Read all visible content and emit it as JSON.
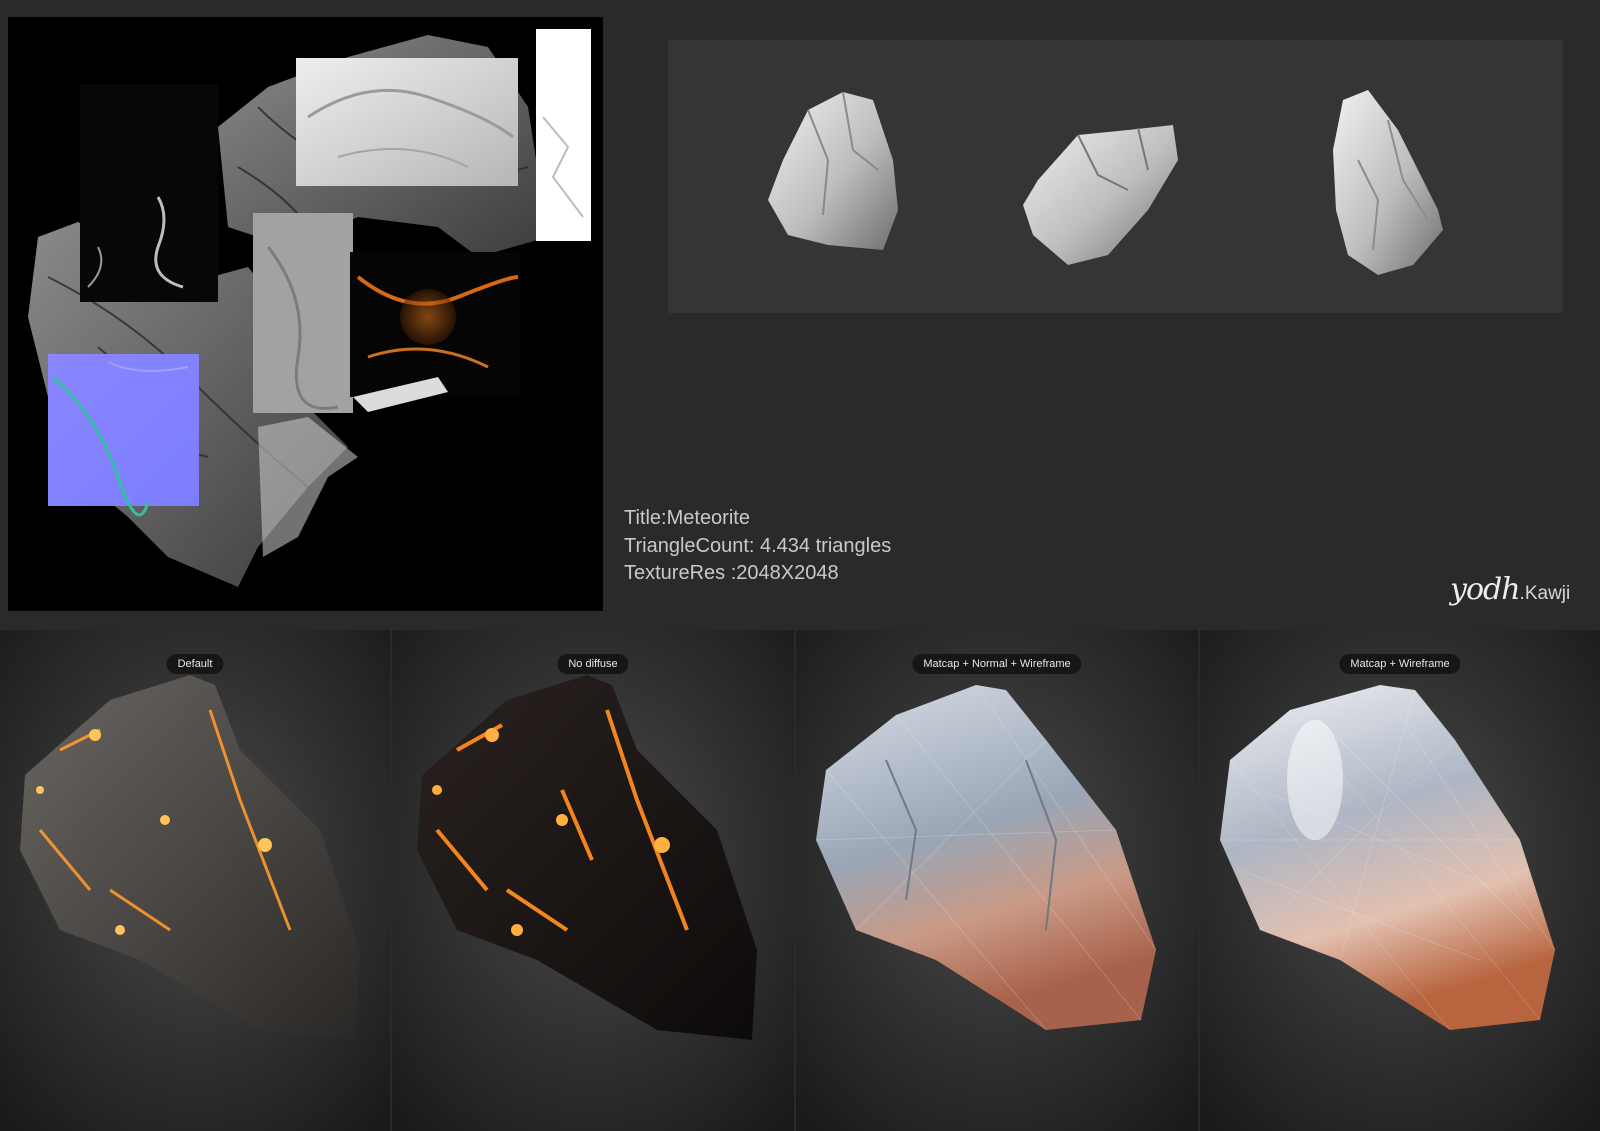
{
  "info": {
    "title": "Title:Meteorite",
    "triangles": "TriangleCount: 4.434 triangles",
    "texture": "TextureRes :2048X2048"
  },
  "signature": {
    "script": "yodh",
    "name": ".Kawji"
  },
  "panels": [
    {
      "label": "Default"
    },
    {
      "label": "No diffuse"
    },
    {
      "label": "Matcap + Normal + Wireframe"
    },
    {
      "label": "Matcap + Wireframe"
    }
  ],
  "colors": {
    "background": "#2a2a2b",
    "sculpt_panel": "#353536",
    "ember": "#ff9a2e",
    "normal_map": "#8080ff"
  }
}
